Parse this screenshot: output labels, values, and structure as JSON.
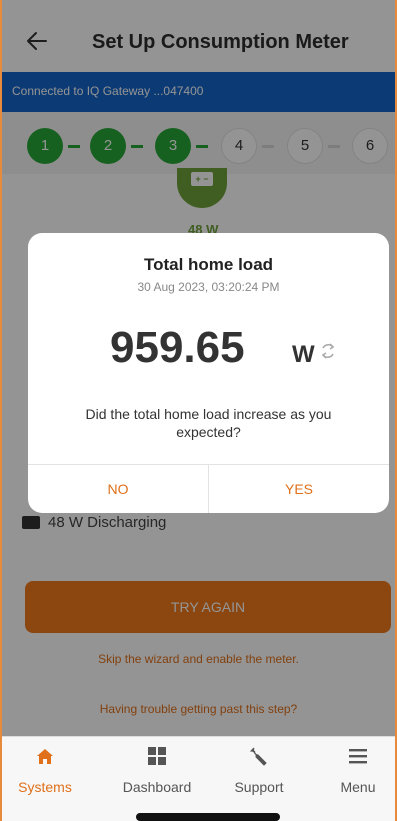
{
  "header": {
    "title": "Set Up Consumption Meter",
    "back_icon": "back-arrow-icon"
  },
  "banner": {
    "text": "Connected to IQ Gateway ...047400"
  },
  "steps": [
    {
      "label": "1",
      "status": "done"
    },
    {
      "label": "2",
      "status": "done"
    },
    {
      "label": "3",
      "status": "done"
    },
    {
      "label": "4",
      "status": "todo"
    },
    {
      "label": "5",
      "status": "todo"
    },
    {
      "label": "6",
      "status": "todo"
    }
  ],
  "background": {
    "battery_label": "+ −",
    "battery_watts": "48 W",
    "discharging_text": "48 W Discharging",
    "try_again_label": "TRY AGAIN",
    "skip_link": "Skip the wizard and enable the meter.",
    "trouble_link": "Having trouble getting past this step?"
  },
  "dialog": {
    "title": "Total home load",
    "timestamp": "30 Aug 2023, 03:20:24 PM",
    "value": "959.65",
    "unit": "W",
    "question": "Did the total home load increase as you expected?",
    "no_label": "NO",
    "yes_label": "YES"
  },
  "bottom_nav": {
    "items": [
      {
        "label": "Systems",
        "icon": "home-icon",
        "active": true
      },
      {
        "label": "Dashboard",
        "icon": "dashboard-icon",
        "active": false
      },
      {
        "label": "Support",
        "icon": "wrench-icon",
        "active": false
      },
      {
        "label": "Menu",
        "icon": "menu-icon",
        "active": false
      }
    ]
  },
  "colors": {
    "accent": "#e0701a",
    "step_done": "#26a737",
    "banner": "#1565c8"
  }
}
